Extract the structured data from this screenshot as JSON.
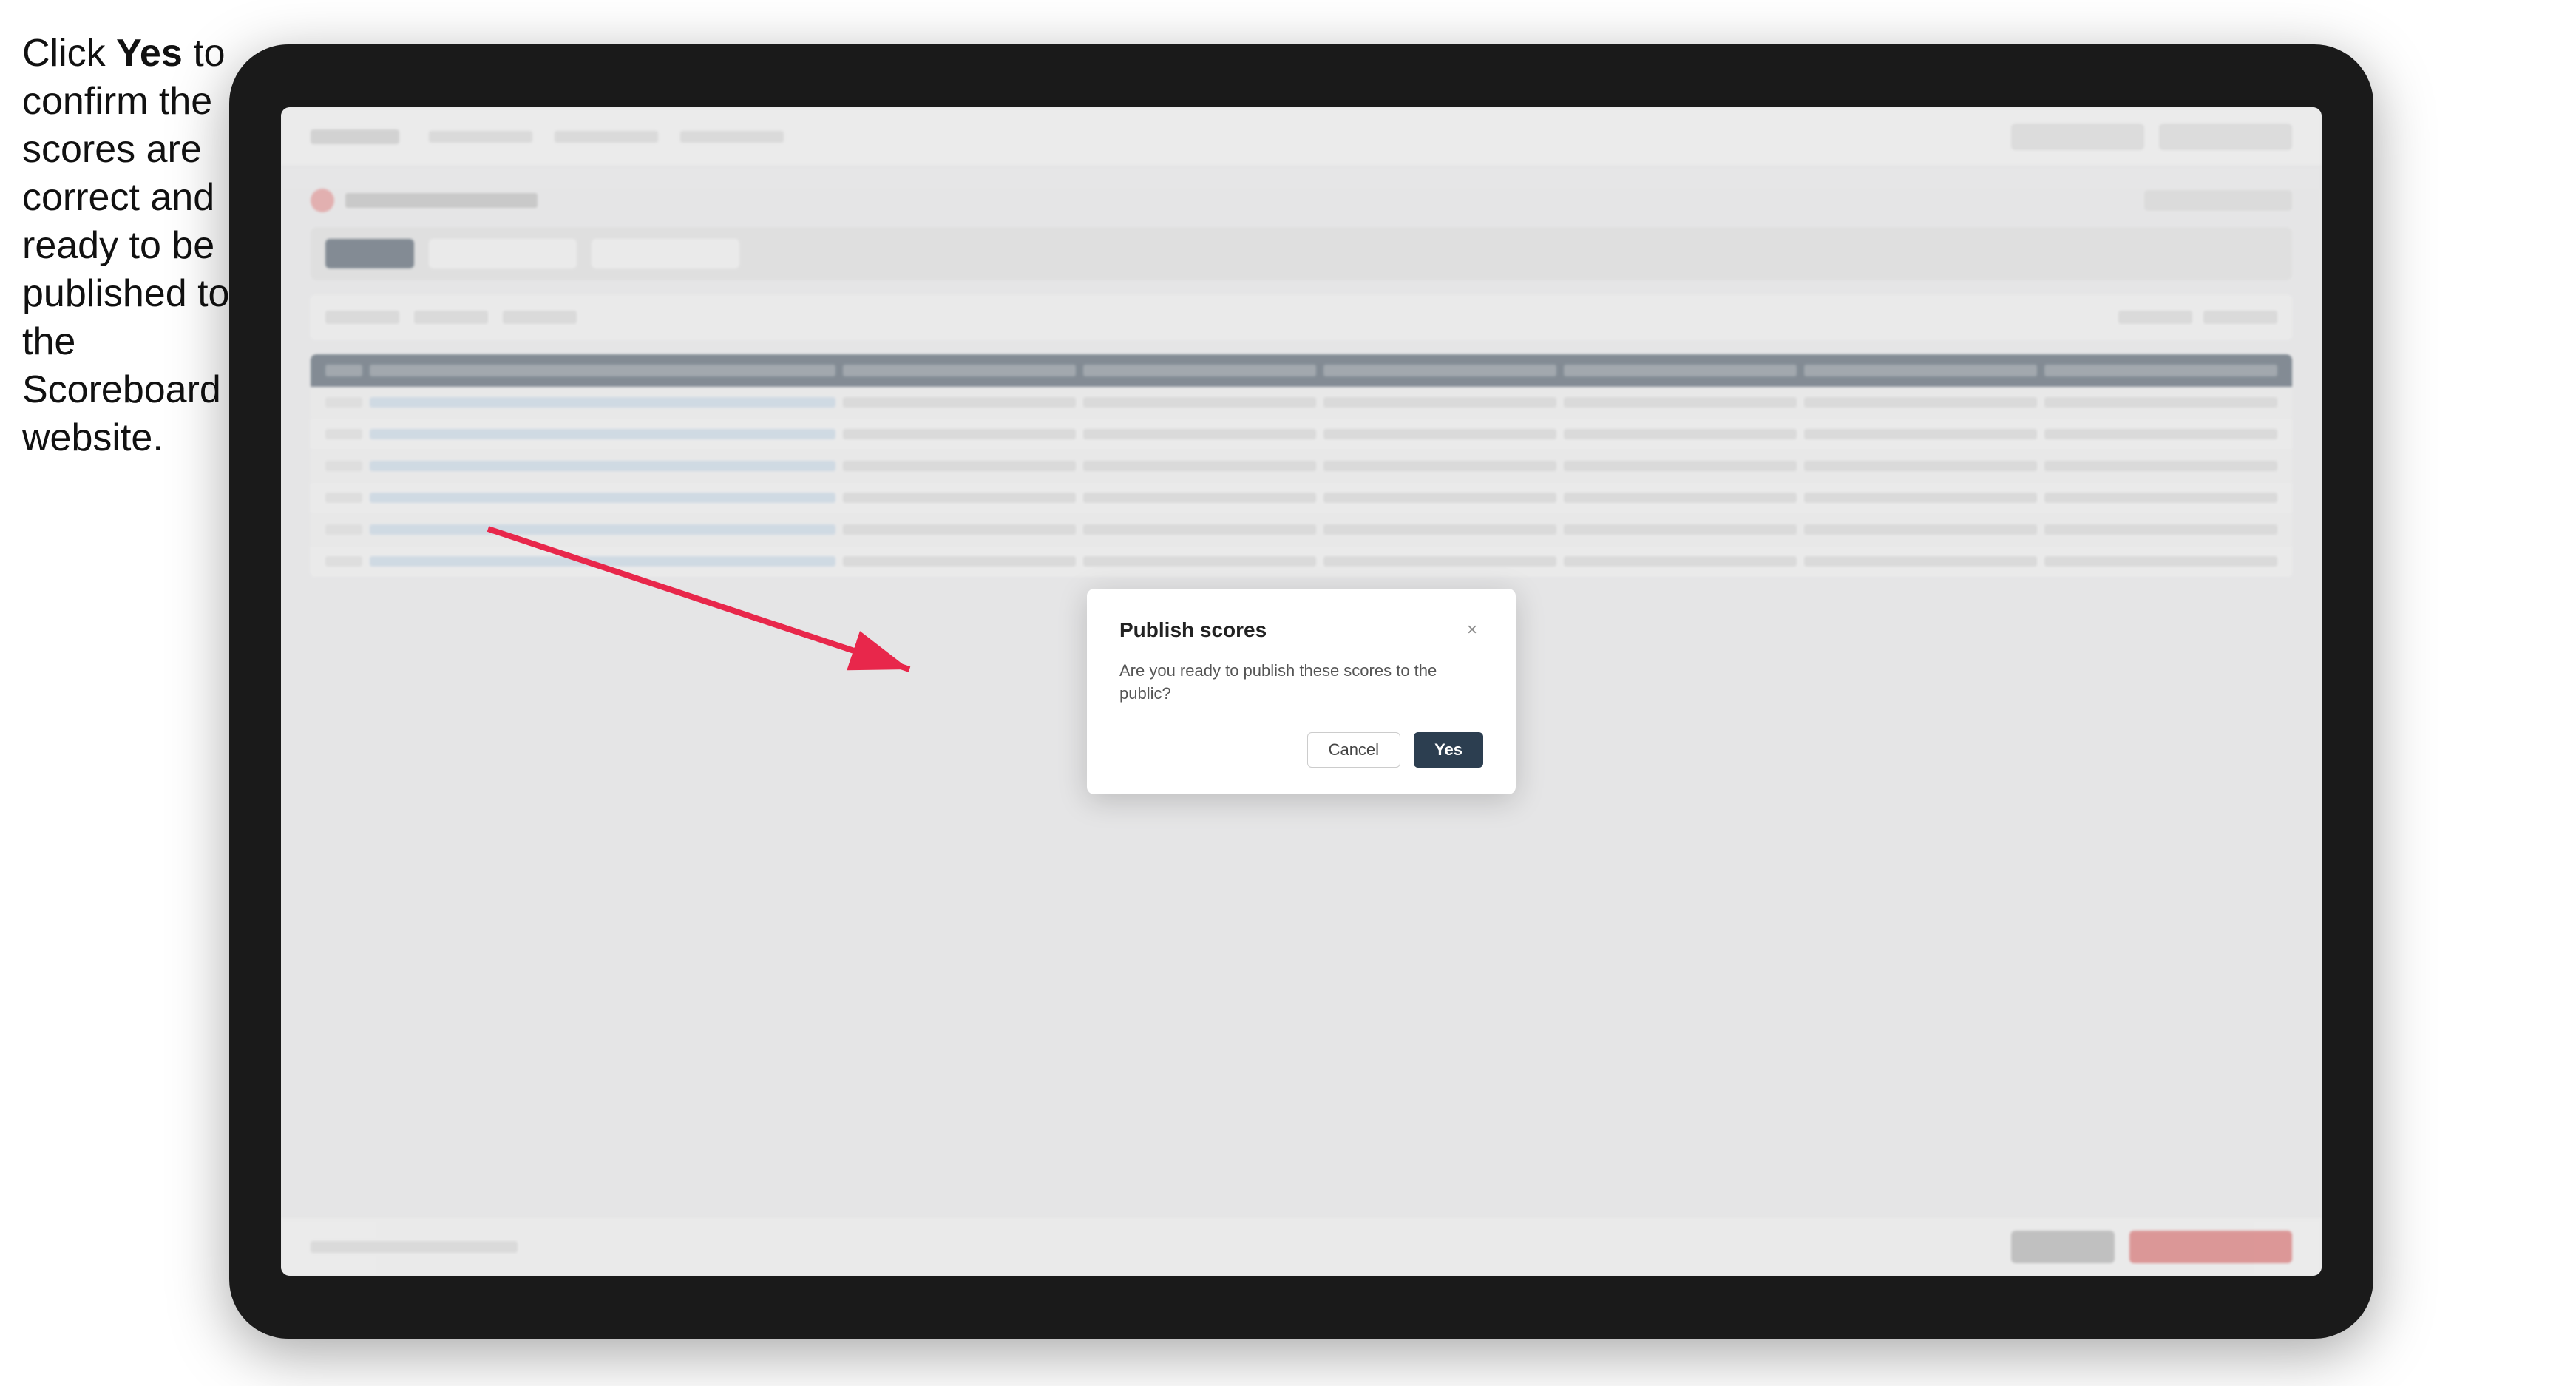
{
  "instruction": {
    "line1": "Click ",
    "bold": "Yes",
    "line2": " to confirm the scores are correct and ready to be published to the Scoreboard website."
  },
  "dialog": {
    "title": "Publish scores",
    "body": "Are you ready to publish these scores to the public?",
    "cancel_label": "Cancel",
    "yes_label": "Yes",
    "close_icon": "×"
  },
  "colors": {
    "yes_button_bg": "#2c3e50",
    "arrow_color": "#e8274b"
  }
}
